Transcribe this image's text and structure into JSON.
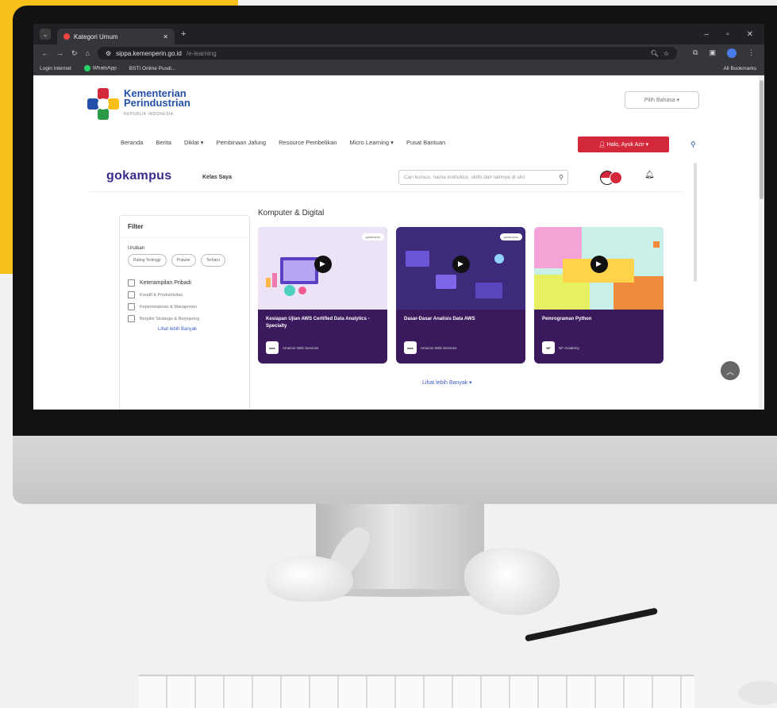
{
  "browser": {
    "tab_title": "Kategori Umum",
    "url_host": "sippa.kemenperin.go.id",
    "url_path": "/e-learning",
    "bookmarks": [
      "Login Internet",
      "WhatsApp",
      "BSTI Online Pusdi..."
    ],
    "all_bookmarks": "All Bookmarks"
  },
  "header": {
    "logo_line1": "Kementerian",
    "logo_line2": "Perindustrian",
    "logo_sub": "REPUBLIK INDONESIA",
    "language_label": "Pilih Bahasa ▾",
    "nav_items": [
      "Beranda",
      "Berita",
      "Diklat ▾",
      "Pembinaan Jafung",
      "Resource Pembelikan",
      "Micro Learning ▾",
      "Pusat Bantuan"
    ],
    "login_label": "Halo, Ayuk Azir ▾"
  },
  "gokampus": {
    "logo": "gokampus",
    "kelas_saya": "Kelas Saya",
    "search_placeholder": "Cari kursus, nama instruktur, skills dan lainnya di sini"
  },
  "filter": {
    "title": "Filter",
    "sort_label": "Urutkan",
    "sort_options": [
      "Rating Tertinggi",
      "Populer",
      "Terbaru"
    ],
    "categories": [
      {
        "label": "Keterampilan Pribadi",
        "main": true
      },
      {
        "label": "Kreatif & Produktivitas",
        "main": false
      },
      {
        "label": "Kepemimpinan & Manajemen",
        "main": false
      },
      {
        "label": "Berpikir Strategis & Berjejaring",
        "main": false
      }
    ],
    "more_label": "Lihat lebih Banyak"
  },
  "main": {
    "section_title": "Komputer & Digital",
    "cards": [
      {
        "title": "Kesiapan Ujian AWS Certified Data Analytics - Specialty",
        "provider": "Amazon Web Services",
        "provider_short": "aws",
        "thumb_bg": "#ece4f6",
        "card_bg": "#3a1a5c"
      },
      {
        "title": "Dasar-Dasar Analisis Data AWS",
        "provider": "Amazon Web Services",
        "provider_short": "aws",
        "thumb_bg": "#3d2a7a",
        "card_bg": "#3a1a5c"
      },
      {
        "title": "Pemrograman Python",
        "provider": "NF Academy",
        "provider_short": "NF",
        "thumb_bg": "#c9f0e8",
        "card_bg": "#3a1a5c"
      }
    ],
    "badge_text": "gokampus",
    "more_label": "Lihat lebih Banyak ▾"
  }
}
